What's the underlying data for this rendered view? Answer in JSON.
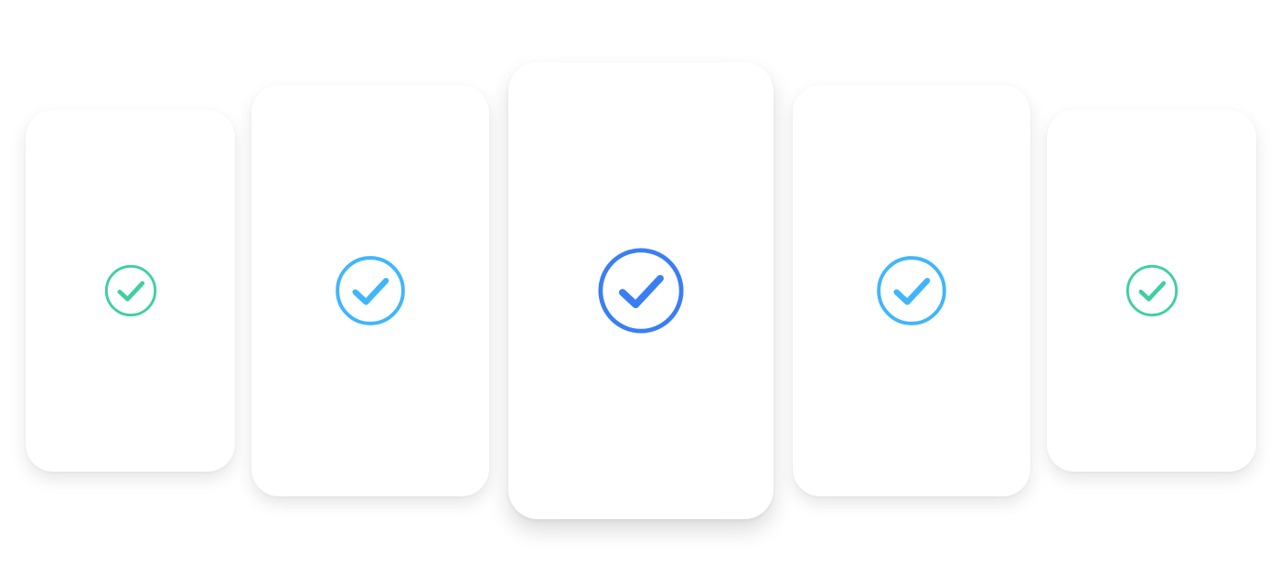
{
  "cards": [
    {
      "id": "card-1",
      "icon": "check-circle-icon",
      "color": "#3ECFA1",
      "selected": false
    },
    {
      "id": "card-2",
      "icon": "check-circle-icon",
      "color": "#40B6FA",
      "selected": false
    },
    {
      "id": "card-3",
      "icon": "check-circle-icon",
      "color": "#3A7EF3",
      "selected": true
    },
    {
      "id": "card-4",
      "icon": "check-circle-icon",
      "color": "#40B6FA",
      "selected": false
    },
    {
      "id": "card-5",
      "icon": "check-circle-icon",
      "color": "#3ECFA1",
      "selected": false
    }
  ]
}
